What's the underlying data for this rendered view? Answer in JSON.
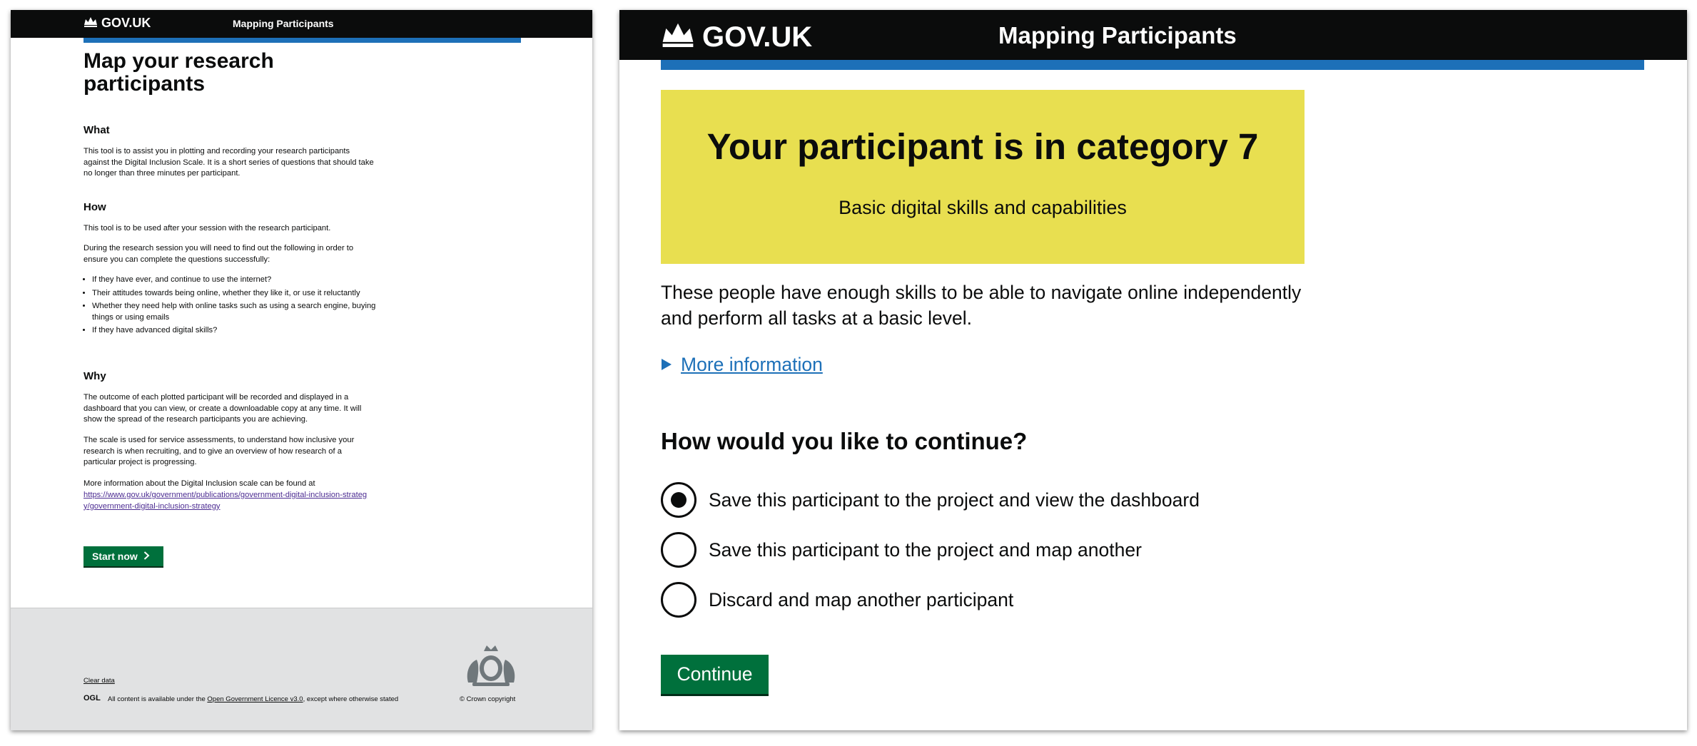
{
  "left_page": {
    "header": {
      "logo_text": "GOV.UK",
      "service_name": "Mapping Participants"
    },
    "title": "Map your research participants",
    "sections": {
      "what": {
        "heading": "What",
        "text": "This tool is to assist you in plotting and recording your research participants against the Digital Inclusion Scale. It is a short series of questions that should take no longer than three minutes per participant."
      },
      "how": {
        "heading": "How",
        "p1": "This tool is to be used after your session with the research participant.",
        "p2": "During the research session you will need to find out the following in order to ensure you can complete the questions successfully:",
        "bullets": [
          "If they have ever, and continue to use the internet?",
          "Their attitudes towards being online, whether they like it, or use it reluctantly",
          "Whether they need help with online tasks such as using a search engine, buying things or using emails",
          "If they have advanced digital skills?"
        ]
      },
      "why": {
        "heading": "Why",
        "p1": "The outcome of each plotted participant will be recorded and displayed in a dashboard that you can view, or create a downloadable copy at any time. It will show the spread of the research participants you are achieving.",
        "p2": "The scale is used for service assessments, to understand how inclusive your research is when recruiting, and to give an overview of how research of a particular project is progressing.",
        "p3": "More information about the Digital Inclusion scale can be found at",
        "link": "https://www.gov.uk/government/publications/government-digital-inclusion-strategy/government-digital-inclusion-strategy"
      }
    },
    "start_button": "Start now",
    "footer": {
      "clear_data": "Clear data",
      "ogl": "OGL",
      "licence_prefix": "All content is available under the",
      "licence_link": "Open Government Licence v3.0",
      "licence_suffix": ", except where otherwise stated",
      "copyright": "© Crown copyright"
    }
  },
  "right_page": {
    "header": {
      "logo_text": "GOV.UK",
      "service_name": "Mapping Participants"
    },
    "panel": {
      "title": "Your participant is in category 7",
      "subtitle": "Basic digital skills and capabilities",
      "color": "#e8df50"
    },
    "description": "These people have enough skills to be able to navigate online independently and perform all tasks at a basic level.",
    "details_summary": "More information",
    "question": "How would you like to continue?",
    "options": [
      {
        "label": "Save this participant to the project and view the dashboard",
        "selected": true
      },
      {
        "label": "Save this participant to the project and map another",
        "selected": false
      },
      {
        "label": "Discard and map another participant",
        "selected": false
      }
    ],
    "continue_button": "Continue"
  },
  "colors": {
    "header": "#0b0c0c",
    "brand_blue": "#1d70b8",
    "button_green": "#00703c",
    "link_purple": "#4c2c92"
  }
}
